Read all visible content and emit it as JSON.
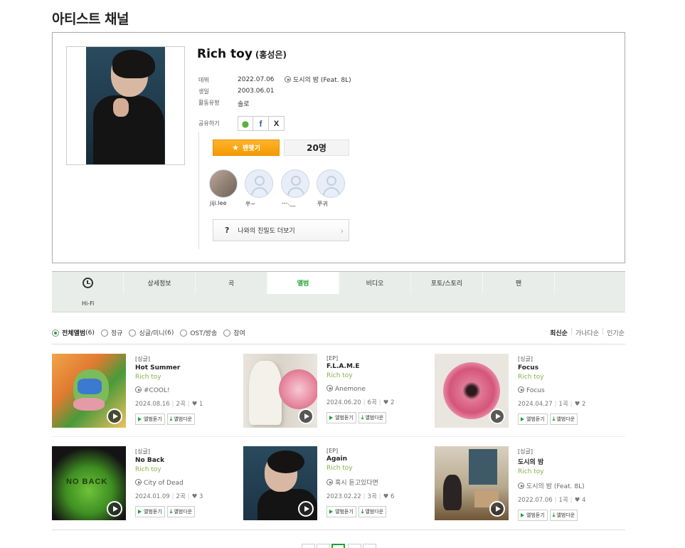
{
  "page": {
    "title": "아티스트 채널"
  },
  "artist": {
    "name": "Rich toy",
    "real_name": "(홍성은)",
    "labels": {
      "debut": "데뷔",
      "birth": "생일",
      "type": "활동유형",
      "share": "공유하기"
    },
    "debut_date": "2022.07.06",
    "debut_song": "도시의 밤 (Feat. 8L)",
    "birth_date": "2003.06.01",
    "activity_type": "솔로",
    "fan_button_label": "팬맺기",
    "fan_count": "20명",
    "closeness_label": "나와의 친밀도 더보기",
    "closeness_icon": "?"
  },
  "share_icons": [
    "kakaostory-icon",
    "facebook-icon",
    "x-icon"
  ],
  "fans": [
    {
      "name": "jiji.lee"
    },
    {
      "name": "쑤~"
    },
    {
      "name": "---.__"
    },
    {
      "name": "쭈귀"
    }
  ],
  "tabs": [
    {
      "label": "Hi-Fi",
      "icon": "clock-icon"
    },
    {
      "label": "상세정보"
    },
    {
      "label": "곡"
    },
    {
      "label": "앨범",
      "active": true
    },
    {
      "label": "비디오"
    },
    {
      "label": "포토/스토리"
    },
    {
      "label": "팬"
    },
    {
      "label": ""
    }
  ],
  "filters": [
    {
      "label": "전체앨범",
      "count": "(6)",
      "selected": true
    },
    {
      "label": "정규",
      "count": ""
    },
    {
      "label": "싱글/미니",
      "count": "(6)"
    },
    {
      "label": "OST/방송",
      "count": ""
    },
    {
      "label": "참여",
      "count": ""
    }
  ],
  "sort": [
    "최신순",
    "가나다순",
    "인기순"
  ],
  "album_buttons": {
    "listen": "앨범듣기",
    "download": "앨범다운"
  },
  "albums": [
    {
      "type": "[싱글]",
      "title": "Hot Summer",
      "artist": "Rich toy",
      "track": "#COOL!",
      "date": "2024.08.16",
      "tracks": "2곡",
      "likes": "1"
    },
    {
      "type": "[EP]",
      "title": "F.L.A.M.E",
      "artist": "Rich toy",
      "track": "Anemone",
      "date": "2024.06.20",
      "tracks": "6곡",
      "likes": "2"
    },
    {
      "type": "[싱글]",
      "title": "Focus",
      "artist": "Rich toy",
      "track": "Focus",
      "date": "2024.04.27",
      "tracks": "1곡",
      "likes": "2"
    },
    {
      "type": "[싱글]",
      "title": "No Back",
      "artist": "Rich toy",
      "track": "City of Dead",
      "date": "2024.01.09",
      "tracks": "2곡",
      "likes": "3"
    },
    {
      "type": "[EP]",
      "title": "Again",
      "artist": "Rich toy",
      "track": "혹시 듣고있다면",
      "date": "2023.02.22",
      "tracks": "3곡",
      "likes": "6"
    },
    {
      "type": "[싱글]",
      "title": "도시의 밤",
      "artist": "Rich toy",
      "track": "도시의 밤 (Feat. 8L)",
      "date": "2022.07.06",
      "tracks": "1곡",
      "likes": "4"
    }
  ],
  "cover_text": {
    "no_back": "NO BACK"
  },
  "pagination": {
    "active_index": 2
  }
}
